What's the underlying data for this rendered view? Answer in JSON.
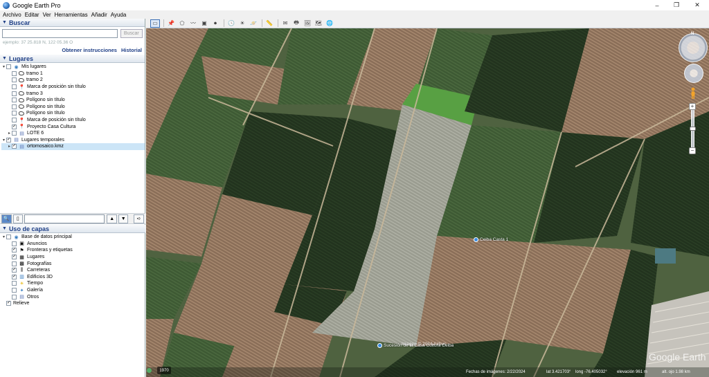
{
  "window": {
    "title": "Google Earth Pro",
    "minimize": "–",
    "maximize": "❐",
    "close": "✕"
  },
  "menu": [
    "Archivo",
    "Editar",
    "Ver",
    "Herramientas",
    "Añadir",
    "Ayuda"
  ],
  "search": {
    "header": "Buscar",
    "placeholder": "",
    "button": "Buscar",
    "hint": "ejemplo: 37 25.818 N, 122 05.36 O",
    "link_directions": "Obtener instrucciones",
    "link_history": "Historial"
  },
  "places": {
    "header": "Lugares",
    "tree": [
      {
        "label": "Mis lugares",
        "level": 0,
        "icon": "folder-earth-icon",
        "expand": "–",
        "checked": false
      },
      {
        "label": "tramo 1",
        "level": 1,
        "icon": "polygon-icon",
        "checked": false
      },
      {
        "label": "tramo 2",
        "level": 1,
        "icon": "polygon-icon",
        "checked": false
      },
      {
        "label": "Marca de posición sin título",
        "level": 1,
        "icon": "pin-icon",
        "checked": false
      },
      {
        "label": "tramo 3",
        "level": 1,
        "icon": "polygon-icon",
        "checked": false
      },
      {
        "label": "Polígono sin título",
        "level": 1,
        "icon": "polygon-icon",
        "checked": false
      },
      {
        "label": "Polígono sin título",
        "level": 1,
        "icon": "polygon-icon",
        "checked": false
      },
      {
        "label": "Polígono sin título",
        "level": 1,
        "icon": "polygon-icon",
        "checked": false
      },
      {
        "label": "Marca de posición sin título",
        "level": 1,
        "icon": "pin-icon",
        "checked": false
      },
      {
        "label": "Proyecto Casa Cultura",
        "level": 1,
        "icon": "pin-icon",
        "checked": true
      },
      {
        "label": "LOTE 6",
        "level": 1,
        "icon": "folder-icon",
        "expand": "+",
        "checked": false
      },
      {
        "label": "Lugares temporales",
        "level": 0,
        "icon": "folder-icon",
        "expand": "–",
        "checked": true
      },
      {
        "label": "ortomosaico.kmz",
        "level": 1,
        "icon": "folder-icon",
        "expand": "+",
        "checked": true,
        "selected": true
      }
    ]
  },
  "layers": {
    "header": "Uso de capas",
    "tree": [
      {
        "label": "Base de datos principal",
        "level": 0,
        "icon": "globe-icon",
        "expand": "–",
        "checked": false
      },
      {
        "label": "Anuncios",
        "level": 1,
        "icon": "ad-icon",
        "checked": false
      },
      {
        "label": "Fronteras y etiquetas",
        "level": 1,
        "icon": "borders-icon",
        "checked": true
      },
      {
        "label": "Lugares",
        "level": 1,
        "icon": "places-icon",
        "checked": true
      },
      {
        "label": "Fotografías",
        "level": 1,
        "icon": "photo-icon",
        "checked": false
      },
      {
        "label": "Carreteras",
        "level": 1,
        "icon": "road-icon",
        "checked": true
      },
      {
        "label": "Edificios 3D",
        "level": 1,
        "icon": "building-icon",
        "checked": true
      },
      {
        "label": "Tiempo",
        "level": 1,
        "icon": "weather-icon",
        "checked": false
      },
      {
        "label": "Galería",
        "level": 1,
        "icon": "gallery-icon",
        "checked": false
      },
      {
        "label": "Otros",
        "level": 1,
        "icon": "folder-icon",
        "checked": false
      },
      {
        "label": "Relieve",
        "level": 0,
        "icon": "",
        "checked": true
      }
    ]
  },
  "map": {
    "placemark_1": "Ceiba Casta 1",
    "placemark_2": "Sucesión de la Casa Cultura Ceiba",
    "copyright": "Imagen © 2024 Airbus",
    "year": "1970",
    "status": {
      "dates": "Fechas de imágenes: 2/22/2024",
      "lat": "lat   3.421703°",
      "long": "long  -76.405032°",
      "elev": "elevación  961 m",
      "eye": "alt. ojo  1.98 km"
    },
    "logo": "Google Earth"
  }
}
